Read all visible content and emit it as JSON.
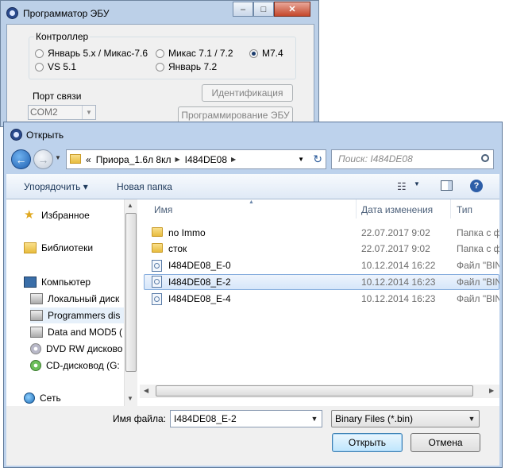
{
  "background_window": {
    "title": "Программатор ЭБУ",
    "controller_group": {
      "legend": "Контроллер",
      "options": [
        {
          "label": "Январь 5.x / Микас-7.6",
          "selected": false
        },
        {
          "label": "Микас 7.1 / 7.2",
          "selected": false
        },
        {
          "label": "M7.4",
          "selected": true
        },
        {
          "label": "VS 5.1",
          "selected": false
        },
        {
          "label": "Январь 7.2",
          "selected": false
        }
      ]
    },
    "port_label": "Порт связи",
    "port_value": "COM2",
    "identify_button": "Идентификация",
    "program_button": "Программирование ЭБУ"
  },
  "dialog": {
    "title": "Открыть",
    "address": {
      "prefix": "«",
      "segments": [
        "Приора_1.6л 8кл",
        "I484DE08"
      ]
    },
    "search_placeholder": "Поиск: I484DE08",
    "toolbar": {
      "organize": "Упорядочить ▾",
      "new_folder": "Новая папка"
    },
    "nav": [
      {
        "label": "Избранное",
        "icon": "star-icon"
      },
      {
        "label": "Библиотеки",
        "icon": "library-icon"
      },
      {
        "label": "Компьютер",
        "icon": "computer-icon"
      },
      {
        "label": "Локальный диск",
        "icon": "drive-icon"
      },
      {
        "label": "Programmers dis",
        "icon": "drive-icon"
      },
      {
        "label": "Data and MOD5 (",
        "icon": "drive-icon"
      },
      {
        "label": "DVD RW дисково",
        "icon": "dvd-icon"
      },
      {
        "label": "CD-дисковод (G:",
        "icon": "cd-icon"
      },
      {
        "label": "Сеть",
        "icon": "network-icon"
      }
    ],
    "columns": {
      "name": "Имя",
      "date": "Дата изменения",
      "type": "Тип"
    },
    "files": [
      {
        "name": "no Immo",
        "date": "22.07.2017 9:02",
        "type": "Папка с ф",
        "kind": "folder",
        "selected": false
      },
      {
        "name": "сток",
        "date": "22.07.2017 9:02",
        "type": "Папка с ф",
        "kind": "folder",
        "selected": false
      },
      {
        "name": "I484DE08_E-0",
        "date": "10.12.2014 16:22",
        "type": "Файл \"BIN",
        "kind": "file",
        "selected": false
      },
      {
        "name": "I484DE08_E-2",
        "date": "10.12.2014 16:23",
        "type": "Файл \"BIN",
        "kind": "file",
        "selected": true
      },
      {
        "name": "I484DE08_E-4",
        "date": "10.12.2014 16:23",
        "type": "Файл \"BIN",
        "kind": "file",
        "selected": false
      }
    ],
    "filename_label": "Имя файла:",
    "filename_value": "I484DE08_E-2",
    "filter_value": "Binary Files (*.bin)",
    "open_button": "Открыть",
    "cancel_button": "Отмена"
  }
}
